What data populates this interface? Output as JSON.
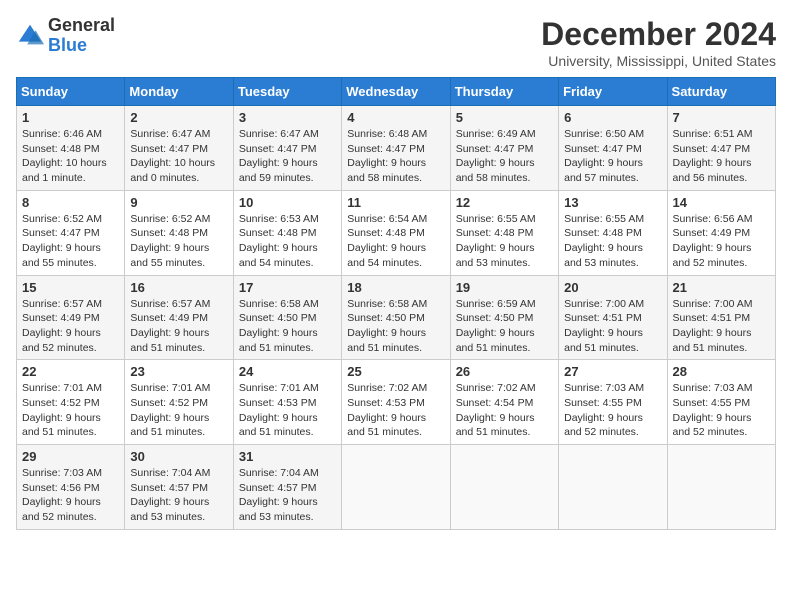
{
  "logo": {
    "general": "General",
    "blue": "Blue"
  },
  "title": "December 2024",
  "location": "University, Mississippi, United States",
  "days_header": [
    "Sunday",
    "Monday",
    "Tuesday",
    "Wednesday",
    "Thursday",
    "Friday",
    "Saturday"
  ],
  "weeks": [
    [
      {
        "day": "1",
        "sunrise": "6:46 AM",
        "sunset": "4:48 PM",
        "daylight": "10 hours and 1 minute."
      },
      {
        "day": "2",
        "sunrise": "6:47 AM",
        "sunset": "4:47 PM",
        "daylight": "10 hours and 0 minutes."
      },
      {
        "day": "3",
        "sunrise": "6:47 AM",
        "sunset": "4:47 PM",
        "daylight": "9 hours and 59 minutes."
      },
      {
        "day": "4",
        "sunrise": "6:48 AM",
        "sunset": "4:47 PM",
        "daylight": "9 hours and 58 minutes."
      },
      {
        "day": "5",
        "sunrise": "6:49 AM",
        "sunset": "4:47 PM",
        "daylight": "9 hours and 58 minutes."
      },
      {
        "day": "6",
        "sunrise": "6:50 AM",
        "sunset": "4:47 PM",
        "daylight": "9 hours and 57 minutes."
      },
      {
        "day": "7",
        "sunrise": "6:51 AM",
        "sunset": "4:47 PM",
        "daylight": "9 hours and 56 minutes."
      }
    ],
    [
      {
        "day": "8",
        "sunrise": "6:52 AM",
        "sunset": "4:47 PM",
        "daylight": "9 hours and 55 minutes."
      },
      {
        "day": "9",
        "sunrise": "6:52 AM",
        "sunset": "4:48 PM",
        "daylight": "9 hours and 55 minutes."
      },
      {
        "day": "10",
        "sunrise": "6:53 AM",
        "sunset": "4:48 PM",
        "daylight": "9 hours and 54 minutes."
      },
      {
        "day": "11",
        "sunrise": "6:54 AM",
        "sunset": "4:48 PM",
        "daylight": "9 hours and 54 minutes."
      },
      {
        "day": "12",
        "sunrise": "6:55 AM",
        "sunset": "4:48 PM",
        "daylight": "9 hours and 53 minutes."
      },
      {
        "day": "13",
        "sunrise": "6:55 AM",
        "sunset": "4:48 PM",
        "daylight": "9 hours and 53 minutes."
      },
      {
        "day": "14",
        "sunrise": "6:56 AM",
        "sunset": "4:49 PM",
        "daylight": "9 hours and 52 minutes."
      }
    ],
    [
      {
        "day": "15",
        "sunrise": "6:57 AM",
        "sunset": "4:49 PM",
        "daylight": "9 hours and 52 minutes."
      },
      {
        "day": "16",
        "sunrise": "6:57 AM",
        "sunset": "4:49 PM",
        "daylight": "9 hours and 51 minutes."
      },
      {
        "day": "17",
        "sunrise": "6:58 AM",
        "sunset": "4:50 PM",
        "daylight": "9 hours and 51 minutes."
      },
      {
        "day": "18",
        "sunrise": "6:58 AM",
        "sunset": "4:50 PM",
        "daylight": "9 hours and 51 minutes."
      },
      {
        "day": "19",
        "sunrise": "6:59 AM",
        "sunset": "4:50 PM",
        "daylight": "9 hours and 51 minutes."
      },
      {
        "day": "20",
        "sunrise": "7:00 AM",
        "sunset": "4:51 PM",
        "daylight": "9 hours and 51 minutes."
      },
      {
        "day": "21",
        "sunrise": "7:00 AM",
        "sunset": "4:51 PM",
        "daylight": "9 hours and 51 minutes."
      }
    ],
    [
      {
        "day": "22",
        "sunrise": "7:01 AM",
        "sunset": "4:52 PM",
        "daylight": "9 hours and 51 minutes."
      },
      {
        "day": "23",
        "sunrise": "7:01 AM",
        "sunset": "4:52 PM",
        "daylight": "9 hours and 51 minutes."
      },
      {
        "day": "24",
        "sunrise": "7:01 AM",
        "sunset": "4:53 PM",
        "daylight": "9 hours and 51 minutes."
      },
      {
        "day": "25",
        "sunrise": "7:02 AM",
        "sunset": "4:53 PM",
        "daylight": "9 hours and 51 minutes."
      },
      {
        "day": "26",
        "sunrise": "7:02 AM",
        "sunset": "4:54 PM",
        "daylight": "9 hours and 51 minutes."
      },
      {
        "day": "27",
        "sunrise": "7:03 AM",
        "sunset": "4:55 PM",
        "daylight": "9 hours and 52 minutes."
      },
      {
        "day": "28",
        "sunrise": "7:03 AM",
        "sunset": "4:55 PM",
        "daylight": "9 hours and 52 minutes."
      }
    ],
    [
      {
        "day": "29",
        "sunrise": "7:03 AM",
        "sunset": "4:56 PM",
        "daylight": "9 hours and 52 minutes."
      },
      {
        "day": "30",
        "sunrise": "7:04 AM",
        "sunset": "4:57 PM",
        "daylight": "9 hours and 53 minutes."
      },
      {
        "day": "31",
        "sunrise": "7:04 AM",
        "sunset": "4:57 PM",
        "daylight": "9 hours and 53 minutes."
      },
      null,
      null,
      null,
      null
    ]
  ]
}
